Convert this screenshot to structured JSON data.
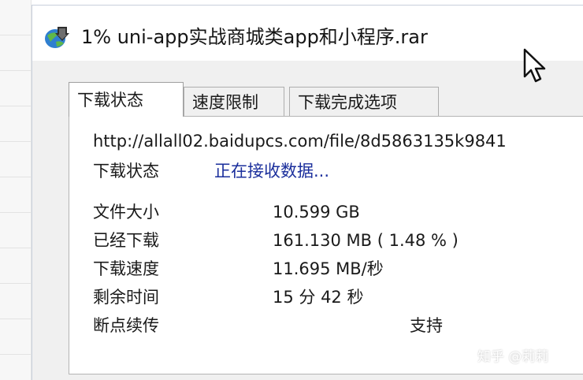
{
  "window": {
    "title": "1% uni-app实战商城类app和小程序.rar",
    "icon": "idm-globe-icon"
  },
  "tabs": [
    {
      "label": "下载状态",
      "active": true
    },
    {
      "label": "速度限制",
      "active": false
    },
    {
      "label": "下载完成选项",
      "active": false
    }
  ],
  "download": {
    "url": "http://allall02.baidupcs.com/file/8d5863135k9841",
    "status_label": "下载状态",
    "status_value": "正在接收数据...",
    "rows": [
      {
        "label": "文件大小",
        "value": "10.599  GB"
      },
      {
        "label": "已经下载",
        "value": "161.130  MB ( 1.48 % )"
      },
      {
        "label": "下载速度",
        "value": "11.695  MB/秒"
      },
      {
        "label": "剩余时间",
        "value": "15 分 42 秒"
      }
    ],
    "resume_label": "断点续传",
    "resume_value": "支持"
  },
  "watermark": "知乎 @莉莉",
  "colors": {
    "status_link": "#1b2f9c",
    "dialog_bg": "#f0f0f0",
    "panel_bg": "#ffffff"
  }
}
